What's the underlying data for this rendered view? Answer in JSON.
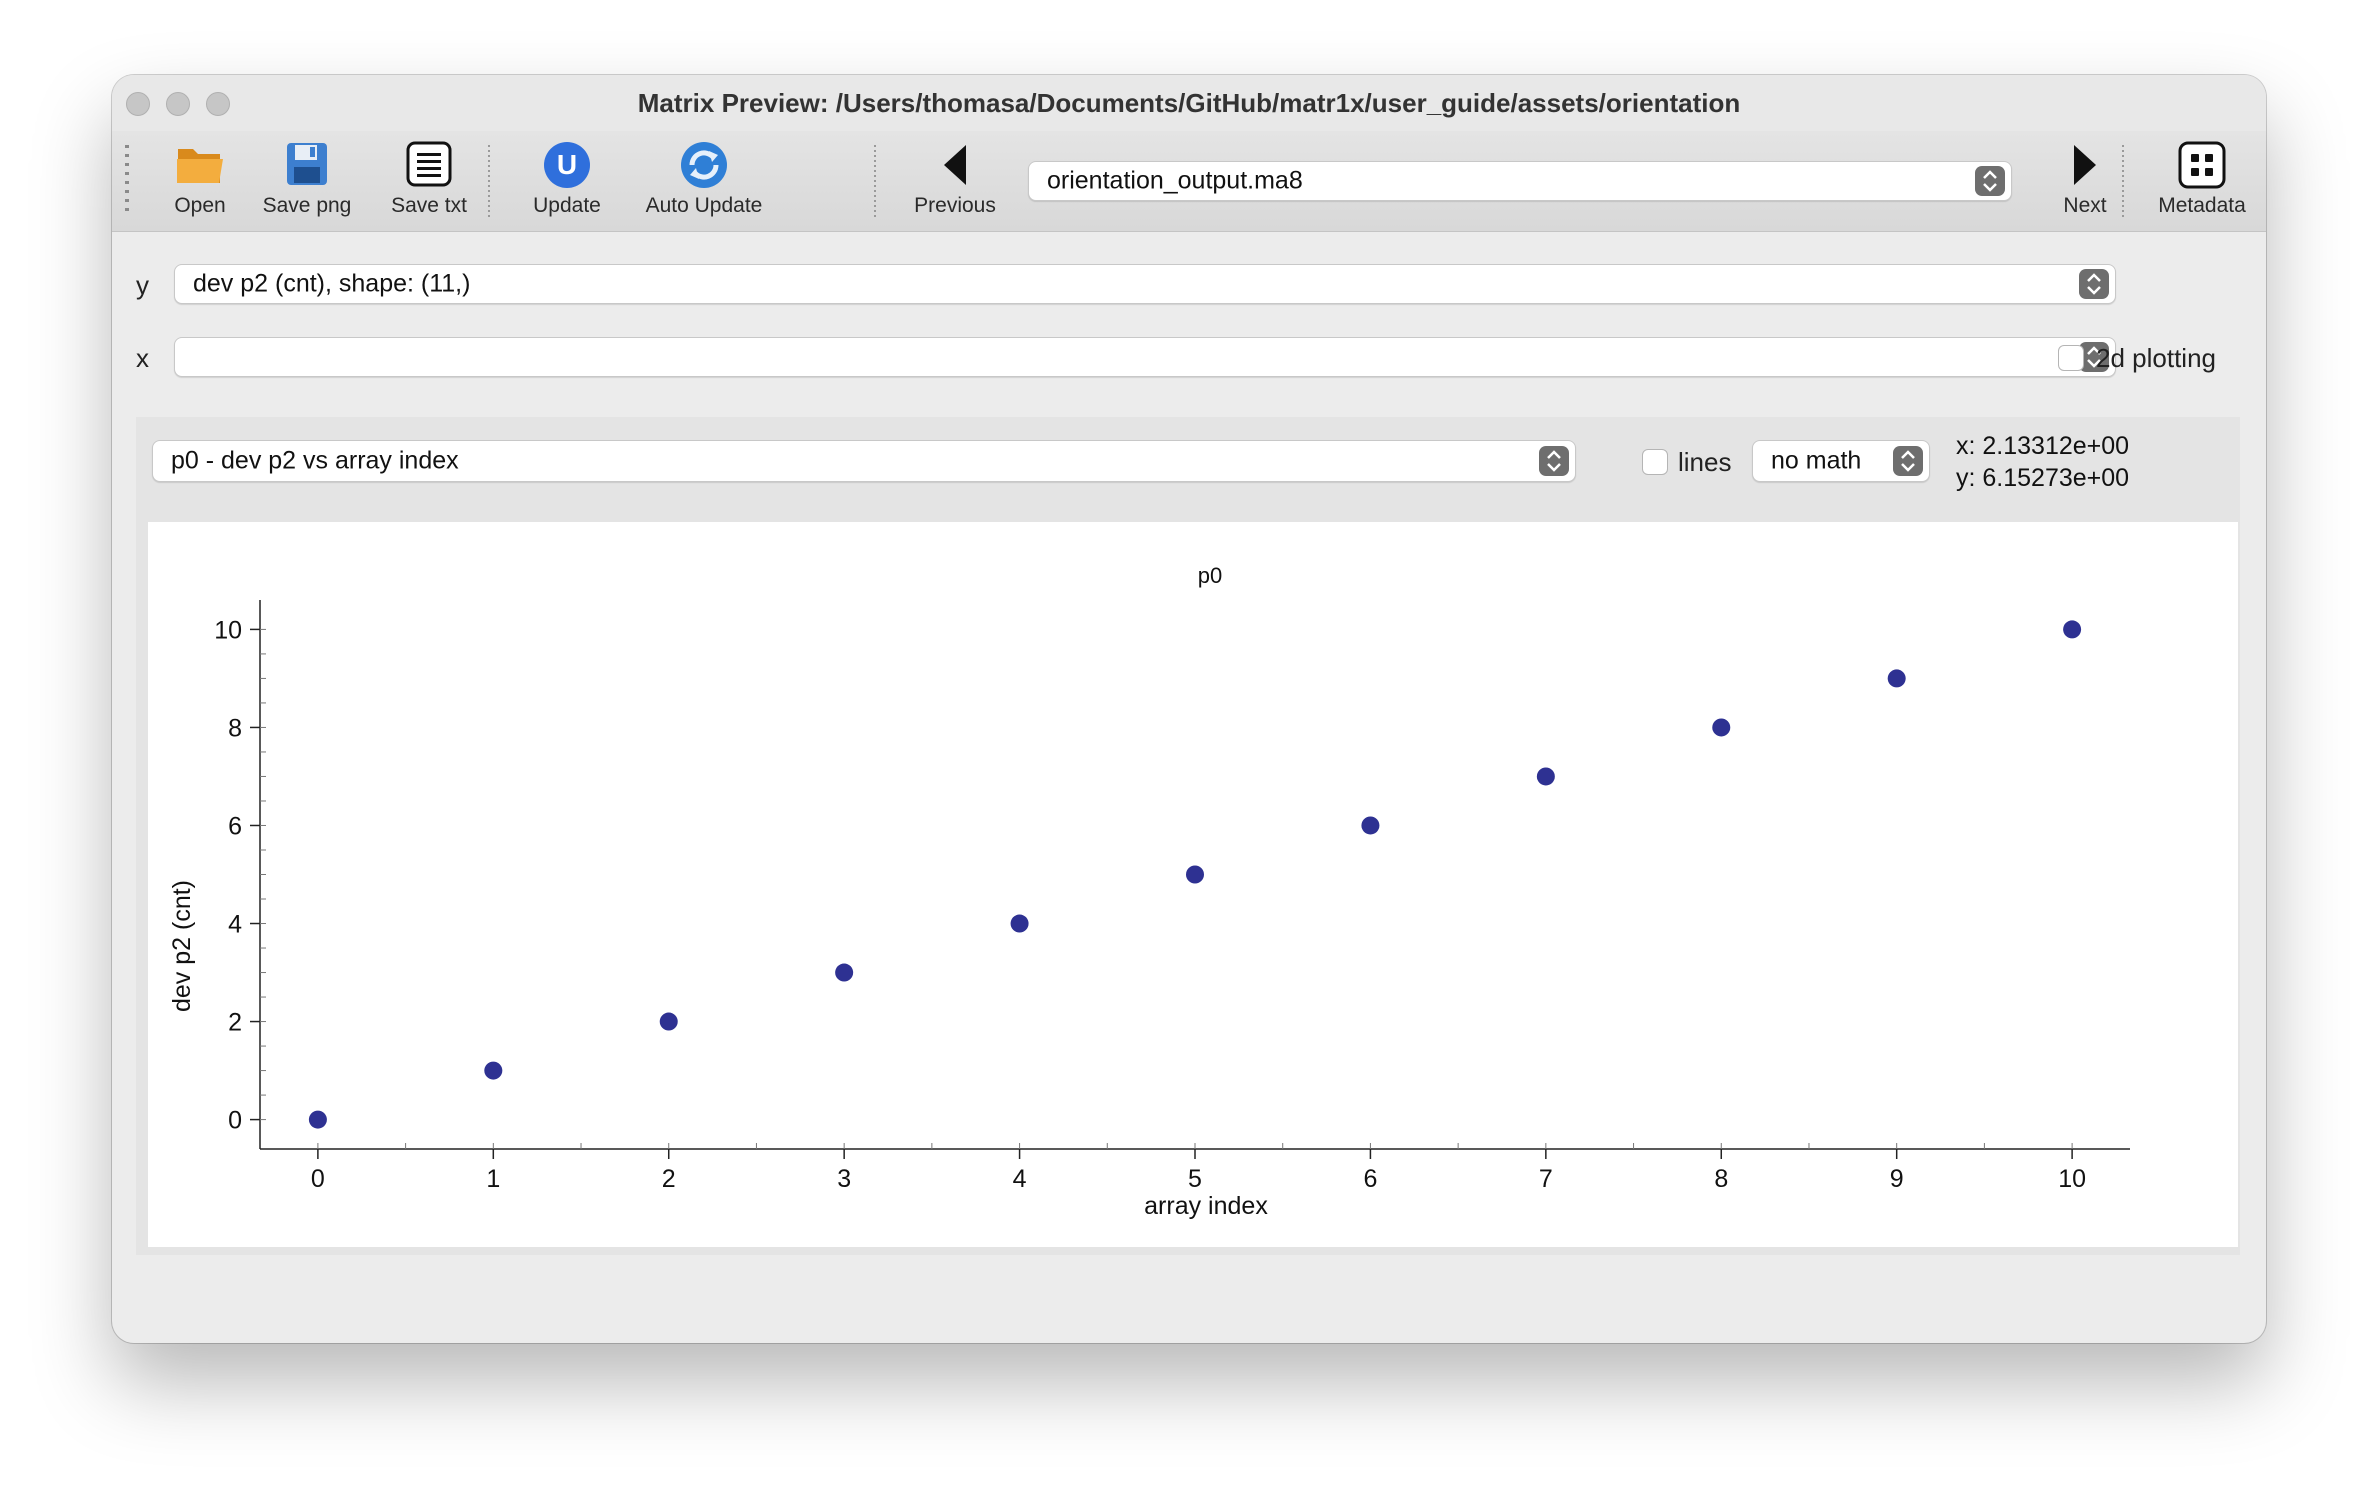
{
  "window": {
    "title": "Matrix Preview: /Users/thomasa/Documents/GitHub/matr1x/user_guide/assets/orientation"
  },
  "toolbar": {
    "open": "Open",
    "save_png": "Save png",
    "save_txt": "Save txt",
    "update": "Update",
    "auto_update": "Auto Update",
    "previous": "Previous",
    "file_select": "orientation_output.ma8",
    "next": "Next",
    "metadata": "Metadata"
  },
  "axes_select": {
    "y_label": "y",
    "y_value": "dev p2 (cnt), shape: (11,)",
    "x_label": "x",
    "x_value": "",
    "plot2d_label": "2d plotting"
  },
  "plot_controls": {
    "plot_select": "p0 - dev p2 vs array index",
    "lines_label": "lines",
    "math_select": "no math",
    "cursor_x": "x: 2.13312e+00",
    "cursor_y": "y: 6.15273e+00"
  },
  "colors": {
    "marker": "#2e3192",
    "update_icon": "#2f6fdc",
    "open_icon": "#f0a12c"
  },
  "chart_data": {
    "type": "scatter",
    "title": "p0",
    "xlabel": "array index",
    "ylabel": "dev p2 (cnt)",
    "x": [
      0,
      1,
      2,
      3,
      4,
      5,
      6,
      7,
      8,
      9,
      10
    ],
    "y": [
      0,
      1,
      2,
      3,
      4,
      5,
      6,
      7,
      8,
      9,
      10
    ],
    "xlim": [
      -0.33,
      10.33
    ],
    "ylim": [
      -0.6,
      10.6
    ],
    "xticks": [
      "0",
      "1",
      "2",
      "3",
      "4",
      "5",
      "6",
      "7",
      "8",
      "9",
      "10"
    ],
    "yticks": [
      "0",
      "2",
      "4",
      "6",
      "8",
      "10"
    ],
    "grid": false
  }
}
